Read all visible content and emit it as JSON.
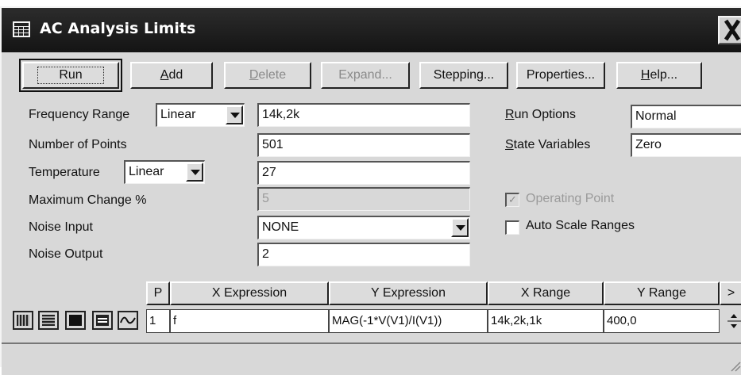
{
  "window": {
    "title": "AC Analysis Limits"
  },
  "toolbar": {
    "run": "Run",
    "add_u": "A",
    "add_rest": "dd",
    "delete_u": "D",
    "delete_rest": "elete",
    "expand": "Expand...",
    "stepping": "Stepping...",
    "properties": "Properties...",
    "help_u": "H",
    "help_rest": "elp..."
  },
  "form": {
    "frequency_range_label": "Frequency Range",
    "frequency_range_mode": "Linear",
    "frequency_range_value": "14k,2k",
    "number_of_points_label": "Number of Points",
    "number_of_points_value": "501",
    "temperature_label": "Temperature",
    "temperature_mode": "Linear",
    "temperature_value": "27",
    "maximum_change_label": "Maximum Change %",
    "maximum_change_value": "5",
    "noise_input_label": "Noise Input",
    "noise_input_value": "NONE",
    "noise_output_label": "Noise Output",
    "noise_output_value": "2"
  },
  "options": {
    "run_options_label_u": "R",
    "run_options_label_rest": "un Options",
    "run_options_value": "Normal",
    "state_variables_label_u": "S",
    "state_variables_label_rest": "tate Variables",
    "state_variables_value": "Zero",
    "operating_point_label": "Operating Point",
    "operating_point_checked": true,
    "operating_point_enabled": false,
    "auto_scale_ranges_label": "Auto Scale Ranges",
    "auto_scale_ranges_checked": false
  },
  "grid": {
    "headers": [
      "P",
      "X Expression",
      "Y Expression",
      "X Range",
      "Y Range",
      ">"
    ],
    "rows": [
      {
        "p": "1",
        "x_expression": "f",
        "y_expression": "MAG(-1*V(V1)/I(V1))",
        "x_range": "14k,2k,1k",
        "y_range": "400,0"
      }
    ]
  },
  "format_buttons": [
    "grid-style-1-icon",
    "grid-style-2-icon",
    "grid-style-3-icon",
    "grid-style-4-icon",
    "plot-icon"
  ],
  "colors": {
    "titlebar": "#1a1a1a",
    "window": "#d8d8d8"
  }
}
